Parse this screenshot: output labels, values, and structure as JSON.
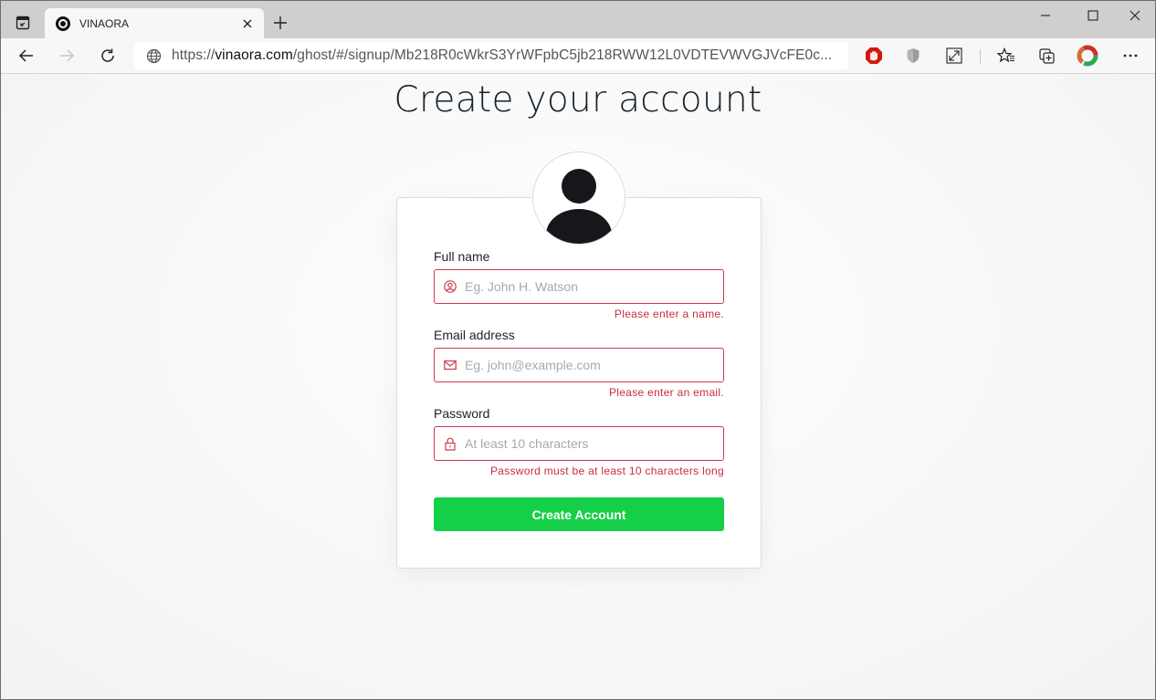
{
  "browser": {
    "tab": {
      "title": "VINAORA",
      "favicon": "circle-logo-icon",
      "close_icon": "close-icon"
    },
    "new_tab_icon": "plus-icon",
    "window_controls": [
      "minimize-icon",
      "maximize-icon",
      "close-icon"
    ],
    "nav": {
      "back_icon": "arrow-left-icon",
      "forward_icon": "arrow-right-icon",
      "refresh_icon": "refresh-icon"
    },
    "url": {
      "scheme": "https://",
      "host": "vinaora.com",
      "path": "/ghost/#/signup/Mb218R0cWkrS3YrWFpbC5jb218RWW12L0VDTEVWVGJVcFE0c..."
    },
    "extensions": [
      "adblock-hand-icon",
      "shield-icon",
      "expand-icon",
      "favorites-icon",
      "collections-icon",
      "profile-ring-icon",
      "more-icon"
    ]
  },
  "page": {
    "title": "Create your account",
    "avatar": "user-silhouette-icon",
    "fields": [
      {
        "label": "Full name",
        "placeholder": "Eg. John H. Watson",
        "value": "",
        "icon": "user-circle-icon",
        "error": "Please enter a name."
      },
      {
        "label": "Email address",
        "placeholder": "Eg. john@example.com",
        "value": "",
        "icon": "envelope-icon",
        "error": "Please enter an email."
      },
      {
        "label": "Password",
        "placeholder": "At least 10 characters",
        "value": "",
        "icon": "lock-icon",
        "error": "Password must be at least 10 characters long"
      }
    ],
    "submit_label": "Create Account",
    "colors": {
      "error": "#c92c3f",
      "accent": "#14cf47"
    }
  }
}
